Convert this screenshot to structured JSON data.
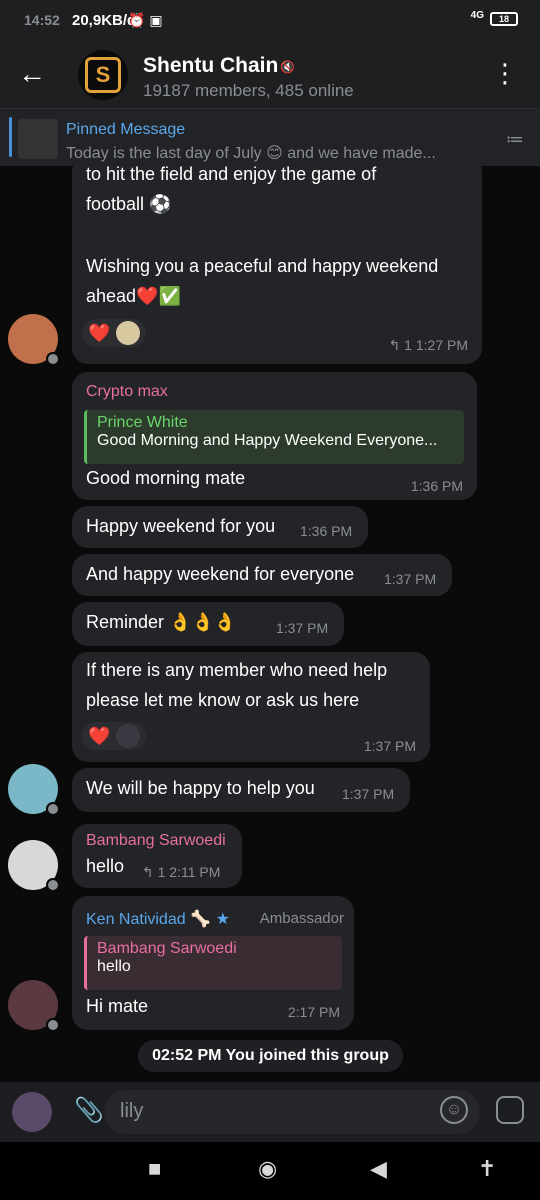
{
  "status": {
    "time": "14:52",
    "speed": "20,9KB/d",
    "icons": "⏰ ▣",
    "net": "4G",
    "battery": "18"
  },
  "header": {
    "title": "Shentu Chain",
    "mute_icon": "🔇",
    "subtitle": "19187 members, 485 online",
    "back_icon": "←",
    "more_icon": "⋮",
    "logo_letter": "S"
  },
  "pinned": {
    "title": "Pinned Message",
    "text": "Today is the last day of July 😊  and we have made...",
    "list_icon": "≔"
  },
  "messages": {
    "m1": {
      "line1": "to hit the field and enjoy the game of",
      "line2": "football ⚽",
      "line3": "Wishing you a peaceful and happy weekend",
      "line4": "ahead❤️✅",
      "reaction": "❤️",
      "reply_count": "↰ 1",
      "time": "1:27 PM"
    },
    "m2": {
      "sender": "Crypto max",
      "reply_name": "Prince White",
      "reply_text": "Good Morning and Happy Weekend Everyone...",
      "text": "Good morning mate",
      "time": "1:36 PM"
    },
    "m3": {
      "text": "Happy weekend for you",
      "time": "1:36 PM"
    },
    "m4": {
      "text": "And happy weekend for everyone",
      "time": "1:37 PM"
    },
    "m5": {
      "text": "Reminder 👌👌👌",
      "time": "1:37 PM"
    },
    "m6": {
      "line1": "If there is any member who need help",
      "line2": "please let me know or ask us here",
      "reaction": "❤️",
      "time": "1:37 PM"
    },
    "m7": {
      "text": "We will be happy to help you",
      "time": "1:37 PM"
    },
    "m8": {
      "sender": "Bambang Sarwoedi",
      "text": "hello",
      "reply_count": "↰ 1",
      "time": "2:11 PM"
    },
    "m9": {
      "sender": "Ken Natividad",
      "sender_emoji": "🦴",
      "star": "★",
      "role": "Ambassador",
      "reply_name": "Bambang Sarwoedi",
      "reply_text": "hello",
      "text": "Hi mate",
      "time": "2:17 PM"
    }
  },
  "notice": "02:52 PM You joined this group",
  "input": {
    "placeholder": "lily",
    "clip_icon": "📎",
    "emoji_icon": "☺"
  },
  "nav": {
    "square": "■",
    "home": "◉",
    "back": "◀",
    "a11y": "✝"
  },
  "colors": {
    "pink_sender": "#e86fa0",
    "green_sender": "#6bd46b",
    "blue_sender": "#5aa7ea",
    "heart": "#e0323a"
  }
}
